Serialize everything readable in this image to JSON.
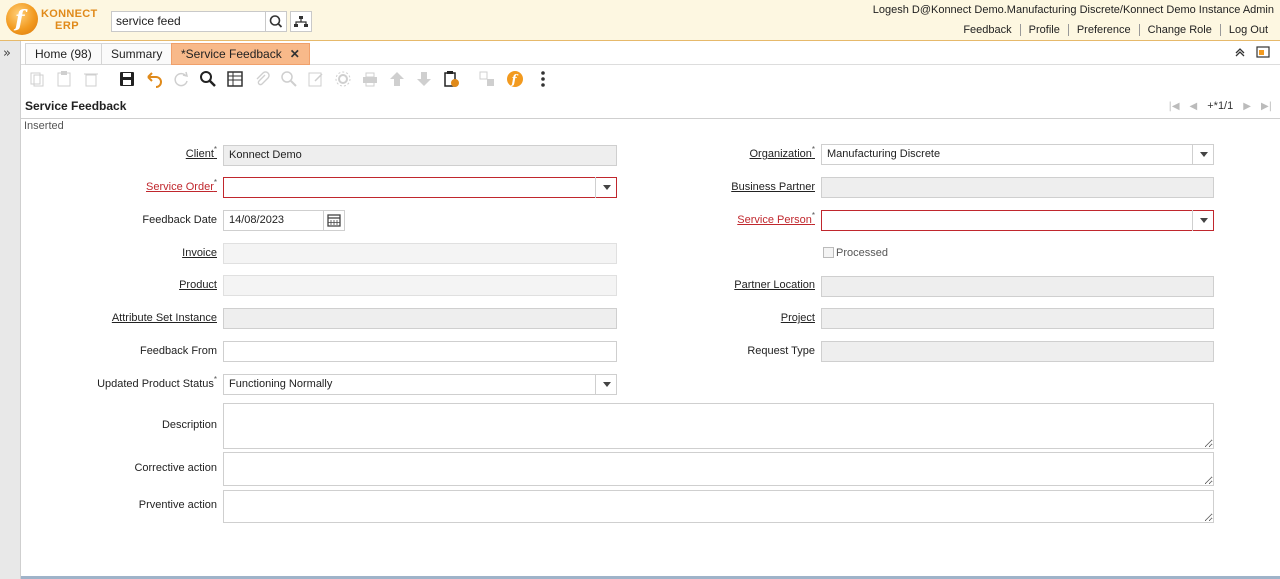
{
  "app": {
    "logo_line1": "KONNECT",
    "logo_line2": "ERP",
    "accent": "#f29a1f"
  },
  "search": {
    "value": "service feed"
  },
  "user": {
    "info": "Logesh D@Konnect Demo.Manufacturing Discrete/Konnect Demo Instance Admin",
    "links": [
      "Feedback",
      "Profile",
      "Preference",
      "Change Role",
      "Log Out"
    ]
  },
  "tabs": [
    {
      "label": "Home (98)"
    },
    {
      "label": "Summary"
    },
    {
      "label": "*Service Feedback",
      "active": true
    }
  ],
  "page": {
    "title": "Service Feedback",
    "record_count": "+*1/1",
    "status": "Inserted"
  },
  "form": {
    "client": {
      "label": "Client",
      "value": "Konnect Demo"
    },
    "organization": {
      "label": "Organization",
      "value": "Manufacturing Discrete"
    },
    "service_order": {
      "label": "Service Order",
      "value": ""
    },
    "business_partner": {
      "label": "Business Partner",
      "value": ""
    },
    "feedback_date": {
      "label": "Feedback Date",
      "value": "14/08/2023"
    },
    "service_person": {
      "label": "Service Person",
      "value": ""
    },
    "invoice": {
      "label": "Invoice",
      "value": ""
    },
    "processed": {
      "label": "Processed"
    },
    "product": {
      "label": "Product",
      "value": ""
    },
    "partner_location": {
      "label": "Partner Location",
      "value": ""
    },
    "attribute_set_instance": {
      "label": "Attribute Set Instance",
      "value": ""
    },
    "project": {
      "label": "Project",
      "value": ""
    },
    "feedback_from": {
      "label": "Feedback From",
      "value": ""
    },
    "request_type": {
      "label": "Request Type",
      "value": ""
    },
    "updated_product_status": {
      "label": "Updated Product Status",
      "value": "Functioning Normally"
    },
    "description": {
      "label": "Description"
    },
    "corrective_action": {
      "label": "Corrective action"
    },
    "preventive_action": {
      "label": "Prventive action"
    }
  }
}
